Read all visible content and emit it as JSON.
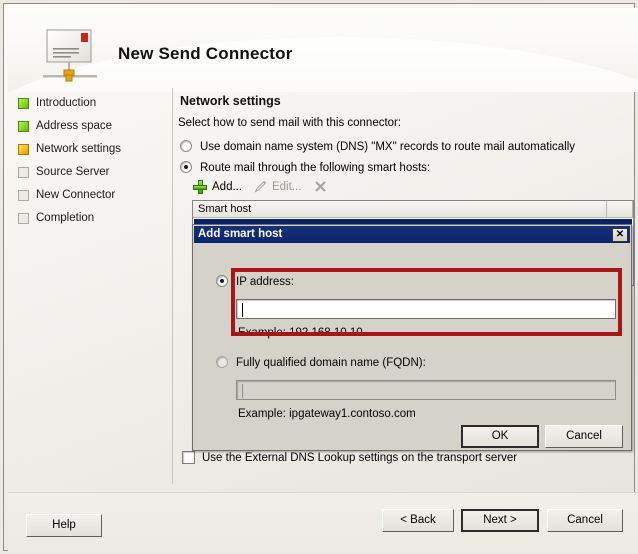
{
  "window": {
    "title": "New Send Connector"
  },
  "header": {
    "title": "New Send Connector",
    "icon": "mail-network-connector-icon"
  },
  "sidebar": {
    "items": [
      {
        "label": "Introduction",
        "state": "done"
      },
      {
        "label": "Address space",
        "state": "done"
      },
      {
        "label": "Network settings",
        "state": "current"
      },
      {
        "label": "Source Server",
        "state": "todo"
      },
      {
        "label": "New Connector",
        "state": "todo"
      },
      {
        "label": "Completion",
        "state": "todo"
      }
    ]
  },
  "main": {
    "heading": "Network settings",
    "instruction": "Select how to send mail with this connector:",
    "options": [
      {
        "label": "Use domain name system (DNS) \"MX\" records to route mail automatically",
        "selected": false
      },
      {
        "label": "Route mail through the following smart hosts:",
        "selected": true
      }
    ],
    "toolbar": {
      "add_label": "Add...",
      "edit_label": "Edit...",
      "delete_label": "",
      "add_icon": "plus-icon",
      "edit_icon": "pencil-icon",
      "delete_icon": "x-icon"
    },
    "list": {
      "columns": [
        "Smart host",
        ""
      ],
      "rows": []
    },
    "dns_lookup_checkbox": {
      "label": "Use the External DNS Lookup settings on the transport server",
      "checked": false
    }
  },
  "dialog": {
    "title": "Add smart host",
    "close_icon": "close-icon",
    "ip_option": {
      "label": "IP address:",
      "selected": true,
      "value": "",
      "example": "Example: 192.168.10.10"
    },
    "fqdn_option": {
      "label": "Fully qualified domain name (FQDN):",
      "selected": false,
      "value": "",
      "example": "Example: ipgateway1.contoso.com"
    },
    "ok_label": "OK",
    "cancel_label": "Cancel",
    "highlight_color": "#a81515"
  },
  "footer": {
    "help_label": "Help",
    "back_label": "< Back",
    "next_label": "Next >",
    "cancel_label": "Cancel"
  }
}
